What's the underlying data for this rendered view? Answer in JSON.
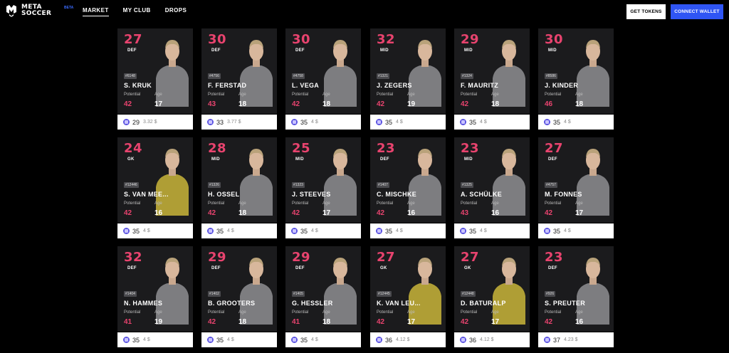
{
  "header": {
    "logo_line1": "META",
    "logo_line2": "SOCCER",
    "logo_badge": "BETA",
    "nav": [
      {
        "label": "MARKET"
      },
      {
        "label": "MY CLUB"
      },
      {
        "label": "DROPS"
      }
    ],
    "get_tokens": "GET TOKENS",
    "connect_wallet": "CONNECT WALLET"
  },
  "colors": {
    "accent_pink": "#e8436e",
    "wallet_blue": "#2f55f4",
    "card_bg": "#1b1b1d",
    "kit_gray": "#8e8e92",
    "kit_gk_yellow": "#c9b53a"
  },
  "labels": {
    "potential": "Potential",
    "age": "Age"
  },
  "cards": [
    {
      "rating": "27",
      "position": "DEF",
      "token_id": "#6148",
      "name": "S. KRUK",
      "potential": "42",
      "age": "17",
      "price": "29",
      "usd": "3.32 $",
      "kit": "gray"
    },
    {
      "rating": "30",
      "position": "DEF",
      "token_id": "#4756",
      "name": "F. FERSTAD",
      "potential": "43",
      "age": "18",
      "price": "33",
      "usd": "3.77 $",
      "kit": "gray"
    },
    {
      "rating": "30",
      "position": "DEF",
      "token_id": "#4758",
      "name": "L. VEGA",
      "potential": "42",
      "age": "18",
      "price": "35",
      "usd": "4 $",
      "kit": "gray"
    },
    {
      "rating": "32",
      "position": "MID",
      "token_id": "#1321",
      "name": "J. ZEGERS",
      "potential": "42",
      "age": "19",
      "price": "35",
      "usd": "4 $",
      "kit": "gray"
    },
    {
      "rating": "29",
      "position": "MID",
      "token_id": "#1324",
      "name": "F. MAURITZ",
      "potential": "42",
      "age": "18",
      "price": "35",
      "usd": "4 $",
      "kit": "gray"
    },
    {
      "rating": "30",
      "position": "MID",
      "token_id": "#8586",
      "name": "J. KINDER",
      "potential": "46",
      "age": "18",
      "price": "35",
      "usd": "4 $",
      "kit": "gray"
    },
    {
      "rating": "24",
      "position": "GK",
      "token_id": "#12446",
      "name": "S. VAN MEE...",
      "potential": "42",
      "age": "16",
      "price": "35",
      "usd": "4 $",
      "kit": "yellow"
    },
    {
      "rating": "28",
      "position": "MID",
      "token_id": "#1326",
      "name": "H. OSSEL",
      "potential": "42",
      "age": "18",
      "price": "35",
      "usd": "4 $",
      "kit": "gray"
    },
    {
      "rating": "25",
      "position": "MID",
      "token_id": "#1323",
      "name": "J. STEEVES",
      "potential": "42",
      "age": "17",
      "price": "35",
      "usd": "4 $",
      "kit": "gray"
    },
    {
      "rating": "23",
      "position": "DEF",
      "token_id": "#1407",
      "name": "C. MISCHKE",
      "potential": "42",
      "age": "16",
      "price": "35",
      "usd": "4 $",
      "kit": "gray"
    },
    {
      "rating": "23",
      "position": "MID",
      "token_id": "#1325",
      "name": "A. SCHÜLKE",
      "potential": "43",
      "age": "16",
      "price": "35",
      "usd": "4 $",
      "kit": "gray"
    },
    {
      "rating": "27",
      "position": "DEF",
      "token_id": "#4757",
      "name": "M. FONNES",
      "potential": "42",
      "age": "17",
      "price": "35",
      "usd": "4 $",
      "kit": "gray"
    },
    {
      "rating": "32",
      "position": "DEF",
      "token_id": "#1404",
      "name": "N. HAMMES",
      "potential": "41",
      "age": "19",
      "price": "35",
      "usd": "4 $",
      "kit": "gray"
    },
    {
      "rating": "29",
      "position": "DEF",
      "token_id": "#1402",
      "name": "B. GROOTERS",
      "potential": "42",
      "age": "18",
      "price": "35",
      "usd": "4 $",
      "kit": "gray"
    },
    {
      "rating": "29",
      "position": "DEF",
      "token_id": "#1405",
      "name": "G. HESSLER",
      "potential": "41",
      "age": "18",
      "price": "35",
      "usd": "4 $",
      "kit": "gray"
    },
    {
      "rating": "27",
      "position": "GK",
      "token_id": "#12445",
      "name": "K. VAN LEU...",
      "potential": "42",
      "age": "17",
      "price": "36",
      "usd": "4.12 $",
      "kit": "yellow"
    },
    {
      "rating": "27",
      "position": "GK",
      "token_id": "#12448",
      "name": "D. BATURALP",
      "potential": "42",
      "age": "17",
      "price": "36",
      "usd": "4.12 $",
      "kit": "yellow"
    },
    {
      "rating": "23",
      "position": "DEF",
      "token_id": "#926",
      "name": "S. PREUTER",
      "potential": "42",
      "age": "16",
      "price": "37",
      "usd": "4.23 $",
      "kit": "gray"
    }
  ]
}
